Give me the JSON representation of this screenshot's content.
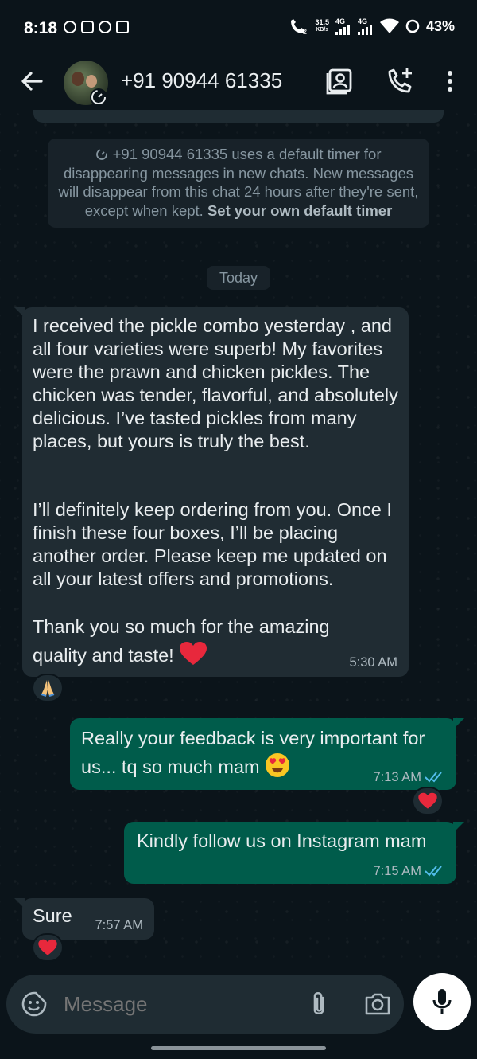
{
  "status_bar": {
    "time": "8:18",
    "net_speed": "31.5",
    "net_unit": "KB/s",
    "sim_label_1": "4G",
    "sim_label_2": "4G",
    "battery": "43%"
  },
  "header": {
    "contact_name": "+91 90944 61335"
  },
  "system_note": {
    "text": "+91 90944 61335 uses a default timer for disappearing messages in new chats. New messages will disappear from this chat 24 hours after they're sent, except when kept.",
    "link": "Set your own default timer"
  },
  "date_divider": "Today",
  "messages": [
    {
      "direction": "incoming",
      "paragraphs": [
        "I received the pickle combo yesterday , and all four varieties were superb! My favorites were the prawn and chicken pickles. The chicken was tender, flavorful, and absolutely delicious. I’ve tasted pickles from many places, but yours is truly the best.",
        "I’ll definitely keep ordering from you. Once I finish these four boxes, I’ll be placing another order. Please keep me updated on all your latest offers and promotions.",
        "Thank you so much for the amazing quality and taste!"
      ],
      "time": "5:30 AM",
      "reaction": "pray-emoji"
    },
    {
      "direction": "outgoing",
      "text": "Really your feedback is very important for us... tq so much mam",
      "time": "7:13 AM",
      "reaction": "heart-emoji"
    },
    {
      "direction": "outgoing",
      "text": "Kindly follow us on Instagram mam",
      "time": "7:15 AM"
    },
    {
      "direction": "incoming",
      "text": "Sure",
      "time": "7:57 AM",
      "reaction": "heart-emoji"
    }
  ],
  "composer": {
    "placeholder": "Message"
  },
  "colors": {
    "background": "#0b141a",
    "incoming_bubble": "#202c33",
    "outgoing_bubble": "#005c4b",
    "read_ticks": "#53bdeb",
    "heart": "#e8283c"
  }
}
